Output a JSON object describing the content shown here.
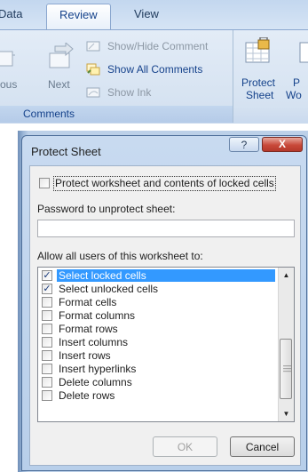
{
  "ribbon": {
    "tabs": {
      "data": "Data",
      "review": "Review",
      "view": "View"
    },
    "comments_group": {
      "previous_label": "ous",
      "next_label": "Next",
      "show_hide": "Show/Hide Comment",
      "show_all": "Show All Comments",
      "show_ink": "Show Ink",
      "group_label": "Comments"
    },
    "protect_sheet": {
      "line1": "Protect",
      "line2": "Sheet"
    },
    "protect_workbook_partial": {
      "line1": "P",
      "line2": "Wo"
    }
  },
  "dialog": {
    "title": "Protect Sheet",
    "help": "?",
    "close": "X",
    "protect_checkbox": {
      "checked": false,
      "label": "Protect worksheet and contents of locked cells"
    },
    "password_label": "Password to unprotect sheet:",
    "password_value": "",
    "allow_label": "Allow all users of this worksheet to:",
    "permissions": [
      {
        "label": "Select locked cells",
        "checked": true,
        "selected": true
      },
      {
        "label": "Select unlocked cells",
        "checked": true,
        "selected": false
      },
      {
        "label": "Format cells",
        "checked": false,
        "selected": false
      },
      {
        "label": "Format columns",
        "checked": false,
        "selected": false
      },
      {
        "label": "Format rows",
        "checked": false,
        "selected": false
      },
      {
        "label": "Insert columns",
        "checked": false,
        "selected": false
      },
      {
        "label": "Insert rows",
        "checked": false,
        "selected": false
      },
      {
        "label": "Insert hyperlinks",
        "checked": false,
        "selected": false
      },
      {
        "label": "Delete columns",
        "checked": false,
        "selected": false
      },
      {
        "label": "Delete rows",
        "checked": false,
        "selected": false
      }
    ],
    "ok_label": "OK",
    "cancel_label": "Cancel"
  },
  "colors": {
    "selection": "#3399ff",
    "ribbon_text": "#15428b",
    "close_button": "#c8493a"
  }
}
